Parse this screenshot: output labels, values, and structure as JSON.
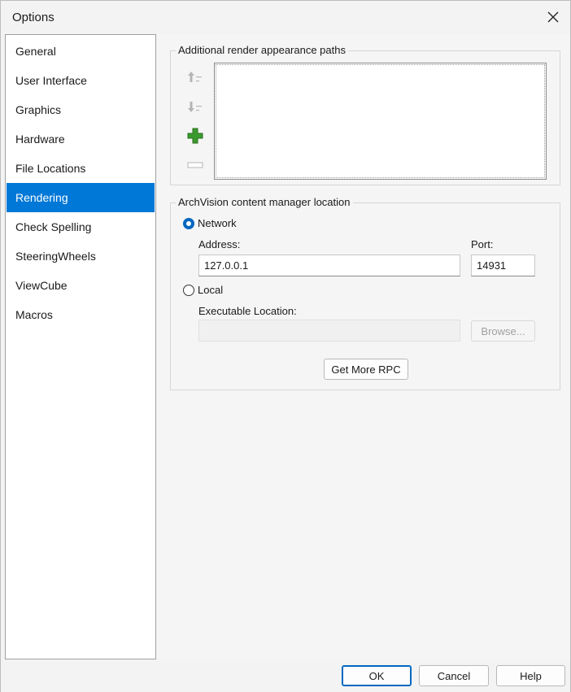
{
  "window": {
    "title": "Options"
  },
  "nav": {
    "items": [
      {
        "label": "General"
      },
      {
        "label": "User Interface"
      },
      {
        "label": "Graphics"
      },
      {
        "label": "Hardware"
      },
      {
        "label": "File Locations"
      },
      {
        "label": "Rendering",
        "selected": true
      },
      {
        "label": "Check Spelling"
      },
      {
        "label": "SteeringWheels"
      },
      {
        "label": "ViewCube"
      },
      {
        "label": "Macros"
      }
    ]
  },
  "render_paths": {
    "group_title": "Additional render appearance paths",
    "icons": [
      "move-up-icon",
      "move-down-icon",
      "add-icon",
      "remove-icon"
    ]
  },
  "archvision": {
    "group_title": "ArchVision content manager location",
    "network_label": "Network",
    "network_selected": true,
    "address_label": "Address:",
    "address_value": "127.0.0.1",
    "port_label": "Port:",
    "port_value": "14931",
    "local_label": "Local",
    "local_selected": false,
    "exec_label": "Executable Location:",
    "exec_value": "",
    "browse_label": "Browse...",
    "get_more_label": "Get More RPC"
  },
  "footer": {
    "ok_label": "OK",
    "cancel_label": "Cancel",
    "help_label": "Help"
  },
  "colors": {
    "selection": "#0078d7",
    "add_icon": "#3a9a2e",
    "radio_checked": "#0067c0"
  }
}
